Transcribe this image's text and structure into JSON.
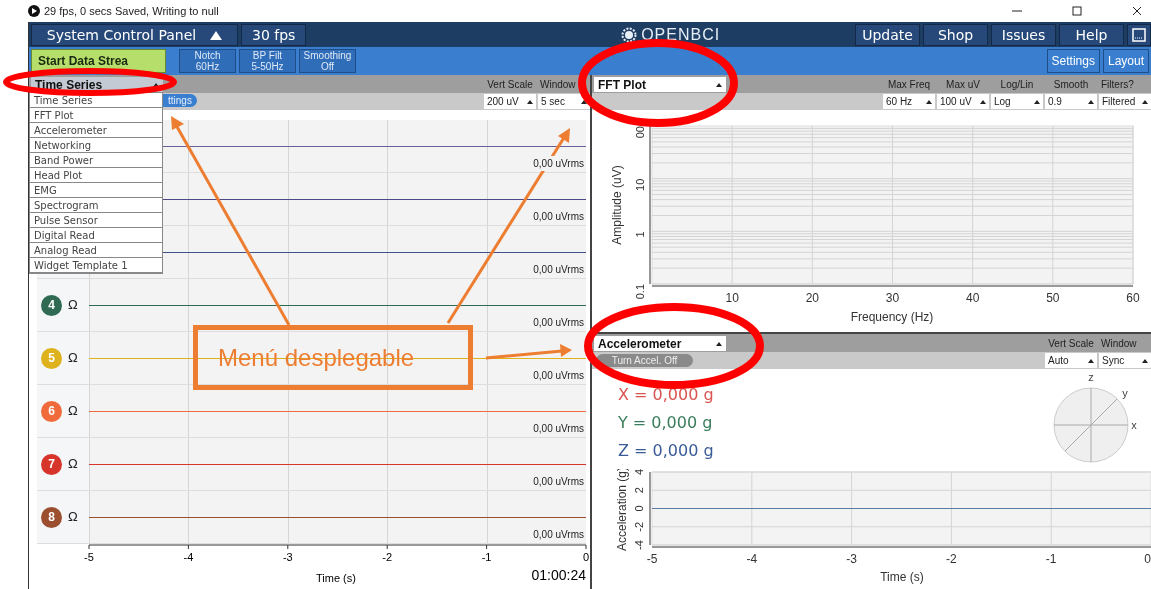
{
  "title_bar": {
    "status": "29 fps, 0 secs Saved, Writing to null"
  },
  "top_bar": {
    "control_panel": "System Control Panel",
    "fps": "30 fps",
    "logo": "OPENBCI",
    "buttons": [
      "Update",
      "Shop",
      "Issues",
      "Help"
    ]
  },
  "toolbar": {
    "start": "Start Data Strea",
    "filters": [
      {
        "line1": "Notch",
        "line2": "60Hz"
      },
      {
        "line1": "BP Filt",
        "line2": "5-50Hz"
      },
      {
        "line1": "Smoothing",
        "line2": "Off"
      }
    ],
    "right_buttons": [
      "Settings",
      "Layout"
    ]
  },
  "time_series": {
    "widget": "Time Series",
    "settings_button": "ttings",
    "controls": [
      {
        "label": "Vert Scale",
        "value": "200 uV"
      },
      {
        "label": "Window",
        "value": "5 sec"
      }
    ],
    "menu": [
      "Time Series",
      "FFT Plot",
      "Accelerometer",
      "Networking",
      "Band Power",
      "Head Plot",
      "EMG",
      "Spectrogram",
      "Pulse Sensor",
      "Digital Read",
      "Analog Read",
      "Widget Template 1"
    ],
    "channels": [
      {
        "reading": "0,00 uVrms",
        "color": "#6a5f96"
      },
      {
        "reading": "0,00 uVrms",
        "color": "#4b4a86"
      },
      {
        "reading": "0,00 uVrms",
        "color": "#3f4f88"
      },
      {
        "number": "4",
        "impedance": "Ω",
        "reading": "0,00 uVrms",
        "color": "#2e6b52"
      },
      {
        "number": "5",
        "impedance": "Ω",
        "reading": "0,00 uVrms",
        "color": "#ddb21c"
      },
      {
        "number": "6",
        "impedance": "Ω",
        "reading": "0,00 uVrms",
        "color": "#f06a3c"
      },
      {
        "number": "7",
        "impedance": "Ω",
        "reading": "0,00 uVrms",
        "color": "#d7352c"
      },
      {
        "number": "8",
        "impedance": "Ω",
        "reading": "0,00 uVrms",
        "color": "#9c4f2e"
      }
    ],
    "x_ticks": [
      "-5",
      "-4",
      "-3",
      "-2",
      "-1",
      "0"
    ],
    "xlabel": "Time (s)",
    "clock": "01:00:24"
  },
  "fft": {
    "widget": "FFT Plot",
    "controls": [
      {
        "label": "Max Freq",
        "value": "60 Hz"
      },
      {
        "label": "Max uV",
        "value": "100 uV"
      },
      {
        "label": "Log/Lin",
        "value": "Log"
      },
      {
        "label": "Smooth",
        "value": "0.9"
      },
      {
        "label": "Filters?",
        "value": "Filtered"
      }
    ],
    "y_ticks": [
      "00",
      "10",
      "1",
      "0.1"
    ],
    "x_ticks": [
      "10",
      "20",
      "30",
      "40",
      "50",
      "60"
    ],
    "xlabel": "Frequency (Hz)",
    "ylabel": "Amplitude (uV)"
  },
  "accelerometer": {
    "widget": "Accelerometer",
    "button": "Turn Accel. Off",
    "controls": [
      {
        "label": "Vert Scale",
        "value": "Auto"
      },
      {
        "label": "Window",
        "value": "Sync"
      }
    ],
    "readings": [
      {
        "text": "X = 0,000 g",
        "color": "#d9534f"
      },
      {
        "text": "Y = 0,000 g",
        "color": "#3a7d5c"
      },
      {
        "text": "Z = 0,000 g",
        "color": "#3b5b98"
      }
    ],
    "axes": [
      "z",
      "y",
      "x"
    ],
    "y_ticks": [
      "4",
      "2",
      "0",
      "-2",
      "-4"
    ],
    "x_ticks": [
      "-5",
      "-4",
      "-3",
      "-2",
      "-1",
      "0"
    ],
    "xlabel": "Time (s)",
    "ylabel": "Acceleration (g)"
  },
  "annotation": {
    "callout": "Menú desplegable"
  }
}
